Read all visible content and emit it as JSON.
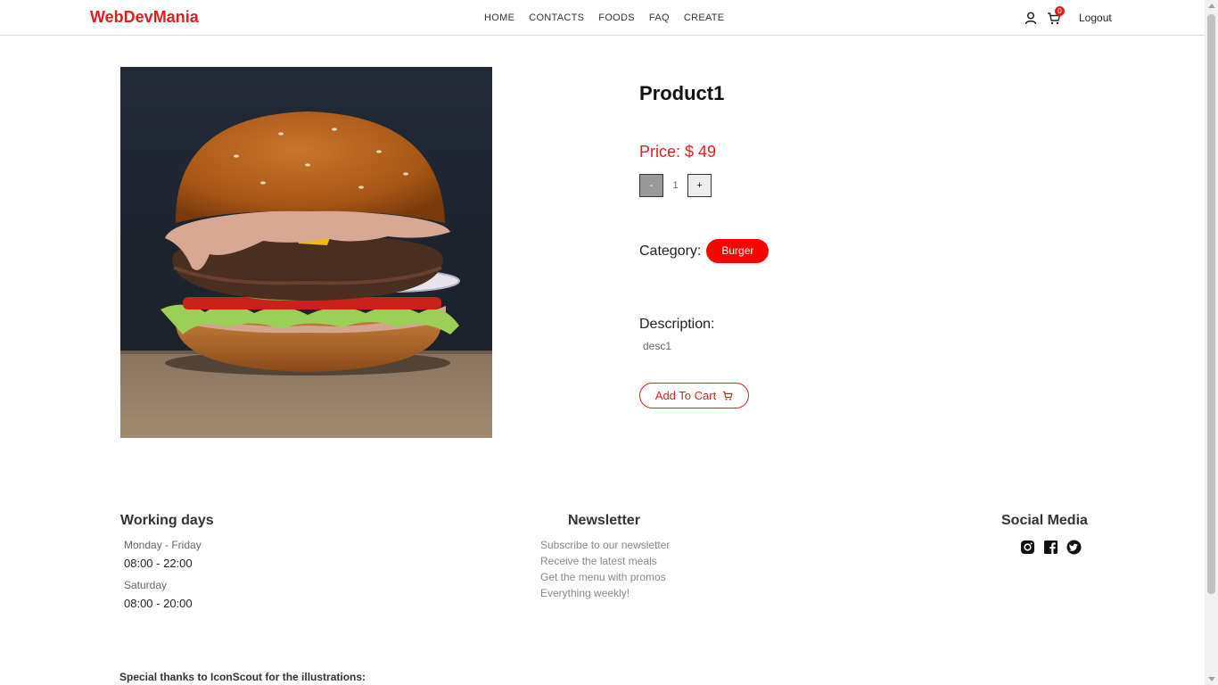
{
  "header": {
    "brand": "WebDevMania",
    "nav": [
      "HOME",
      "CONTACTS",
      "FOODS",
      "FAQ",
      "CREATE"
    ],
    "cart_count": "0",
    "logout_label": "Logout",
    "icons": [
      "user-icon",
      "cart-icon"
    ]
  },
  "product": {
    "title": "Product1",
    "price": "Price: $ 49",
    "quantity": "1",
    "minus_label": "-",
    "plus_label": "+",
    "category_label": "Category:",
    "category": "Burger",
    "description_label": "Description:",
    "description": "desc1",
    "add_to_cart_label": "Add To Cart"
  },
  "footer": {
    "working_days": {
      "title": "Working days",
      "weekday_label": "Monday - Friday",
      "weekday_hours": "08:00 - 22:00",
      "saturday_label": "Saturday",
      "saturday_hours": "08:00 - 20:00"
    },
    "newsletter": {
      "title": "Newsletter",
      "lines": [
        "Subscribe to our newsletter",
        "Receive the latest meals",
        "Get the menu with promos",
        "Everything weekly!"
      ]
    },
    "social": {
      "title": "Social Media",
      "icons": [
        "instagram-icon",
        "facebook-icon",
        "twitter-icon"
      ]
    },
    "thanks": "Special thanks to IconScout for the illustrations:"
  },
  "colors": {
    "accent": "#e02020",
    "badge": "#ff0000"
  }
}
